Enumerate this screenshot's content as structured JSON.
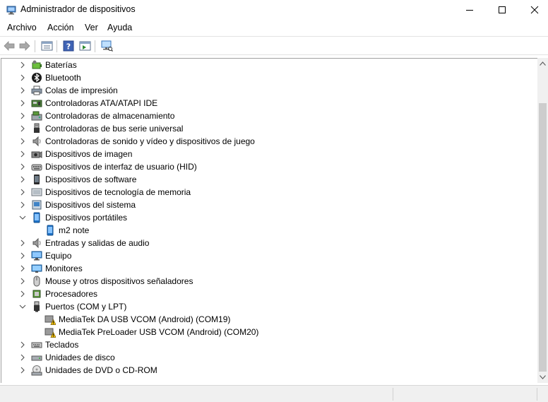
{
  "window": {
    "title": "Administrador de dispositivos",
    "buttons": {
      "minimize": "minimize-icon",
      "maximize": "maximize-icon",
      "close": "close-icon"
    }
  },
  "menu": {
    "items": [
      {
        "label": "Archivo"
      },
      {
        "label": "Acción"
      },
      {
        "label": "Ver"
      },
      {
        "label": "Ayuda"
      }
    ]
  },
  "toolbar": {
    "buttons": [
      "back-icon",
      "forward-icon",
      "properties-icon",
      "help-icon",
      "show-hidden-icon",
      "scan-hardware-icon"
    ]
  },
  "tree": {
    "rows": [
      {
        "label": "Baterías",
        "icon": "battery-icon",
        "level": 0,
        "expanded": false
      },
      {
        "label": "Bluetooth",
        "icon": "bluetooth-icon",
        "level": 0,
        "expanded": false
      },
      {
        "label": "Colas de impresión",
        "icon": "printer-icon",
        "level": 0,
        "expanded": false
      },
      {
        "label": "Controladoras ATA/ATAPI IDE",
        "icon": "ide-controller-icon",
        "level": 0,
        "expanded": false
      },
      {
        "label": "Controladoras de almacenamiento",
        "icon": "storage-controller-icon",
        "level": 0,
        "expanded": false
      },
      {
        "label": "Controladoras de bus serie universal",
        "icon": "usb-icon",
        "level": 0,
        "expanded": false
      },
      {
        "label": "Controladoras de sonido y vídeo y dispositivos de juego",
        "icon": "speaker-icon",
        "level": 0,
        "expanded": false
      },
      {
        "label": "Dispositivos de imagen",
        "icon": "camera-icon",
        "level": 0,
        "expanded": false
      },
      {
        "label": "Dispositivos de interfaz de usuario (HID)",
        "icon": "hid-icon",
        "level": 0,
        "expanded": false
      },
      {
        "label": "Dispositivos de software",
        "icon": "software-device-icon",
        "level": 0,
        "expanded": false
      },
      {
        "label": "Dispositivos de tecnología de memoria",
        "icon": "memory-icon",
        "level": 0,
        "expanded": false
      },
      {
        "label": "Dispositivos del sistema",
        "icon": "system-device-icon",
        "level": 0,
        "expanded": false
      },
      {
        "label": "Dispositivos portátiles",
        "icon": "portable-device-icon",
        "level": 0,
        "expanded": true
      },
      {
        "label": "m2 note",
        "icon": "portable-device-icon",
        "level": 1
      },
      {
        "label": "Entradas y salidas de audio",
        "icon": "speaker-icon",
        "level": 0,
        "expanded": false
      },
      {
        "label": "Equipo",
        "icon": "computer-icon",
        "level": 0,
        "expanded": false
      },
      {
        "label": "Monitores",
        "icon": "monitor-icon",
        "level": 0,
        "expanded": false
      },
      {
        "label": "Mouse y otros dispositivos señaladores",
        "icon": "mouse-icon",
        "level": 0,
        "expanded": false
      },
      {
        "label": "Procesadores",
        "icon": "processor-icon",
        "level": 0,
        "expanded": false
      },
      {
        "label": "Puertos (COM y LPT)",
        "icon": "port-icon",
        "level": 0,
        "expanded": true
      },
      {
        "label": "MediaTek DA USB VCOM (Android) (COM19)",
        "icon": "warning-icon",
        "level": 1
      },
      {
        "label": "MediaTek PreLoader USB VCOM (Android) (COM20)",
        "icon": "warning-icon",
        "level": 1
      },
      {
        "label": "Teclados",
        "icon": "keyboard-icon",
        "level": 0,
        "expanded": false
      },
      {
        "label": "Unidades de disco",
        "icon": "disk-drive-icon",
        "level": 0,
        "expanded": false
      },
      {
        "label": "Unidades de DVD o CD-ROM",
        "icon": "dvd-drive-icon",
        "level": 0,
        "expanded": false
      }
    ]
  },
  "colors": {
    "accent": "#1e72c8",
    "warning": "#f5c400",
    "selection": "#cce8ff"
  }
}
